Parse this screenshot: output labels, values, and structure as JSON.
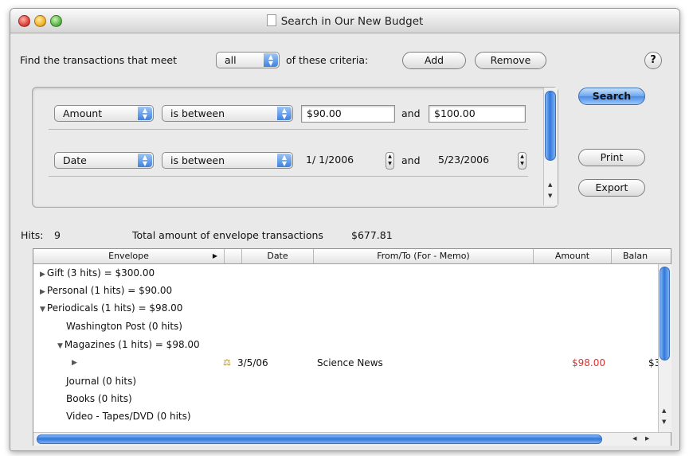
{
  "window": {
    "title": "Search in Our New Budget"
  },
  "criteria_bar": {
    "prefix": "Find the transactions that meet",
    "match_value": "all",
    "suffix": "of these criteria:",
    "add_label": "Add",
    "remove_label": "Remove",
    "help_label": "?"
  },
  "criteria": [
    {
      "field": "Amount",
      "operator": "is between",
      "from": "$90.00",
      "and": "and",
      "to": "$100.00"
    },
    {
      "field": "Date",
      "operator": "is between",
      "from": "1/ 1/2006",
      "and": "and",
      "to": "5/23/2006"
    }
  ],
  "actions": {
    "search_label": "Search",
    "print_label": "Print",
    "export_label": "Export"
  },
  "summary": {
    "hits_label": "Hits:",
    "hits_value": "9",
    "total_label": "Total amount of envelope transactions",
    "total_value": "$677.81"
  },
  "table": {
    "columns": [
      "Envelope",
      "Date",
      "From/To  (For - Memo)",
      "Amount",
      "Balan"
    ],
    "rows": [
      {
        "label": "Gift (3 hits) = $300.00",
        "expander": "▶"
      },
      {
        "label": "Personal (1 hits) = $90.00",
        "expander": "▶"
      },
      {
        "label": "Periodicals (1 hits) = $98.00",
        "expander": "▼"
      },
      {
        "label": "Washington Post (0 hits)",
        "expander": ""
      },
      {
        "label": "Magazines (1 hits) = $98.00",
        "expander": "▼"
      },
      {
        "label": "",
        "expander": "▶",
        "date": "3/5/06",
        "payee": "Science News",
        "amount": "$98.00",
        "balance": "$3"
      },
      {
        "label": "Journal (0 hits)",
        "expander": ""
      },
      {
        "label": "Books (0 hits)",
        "expander": ""
      },
      {
        "label": "Video - Tapes/DVD (0 hits)",
        "expander": ""
      }
    ]
  },
  "colors": {
    "accent": "#3f82e0",
    "negative_amount": "#e03030"
  },
  "icons": {
    "transaction": "scale-icon",
    "document": "document-icon"
  }
}
